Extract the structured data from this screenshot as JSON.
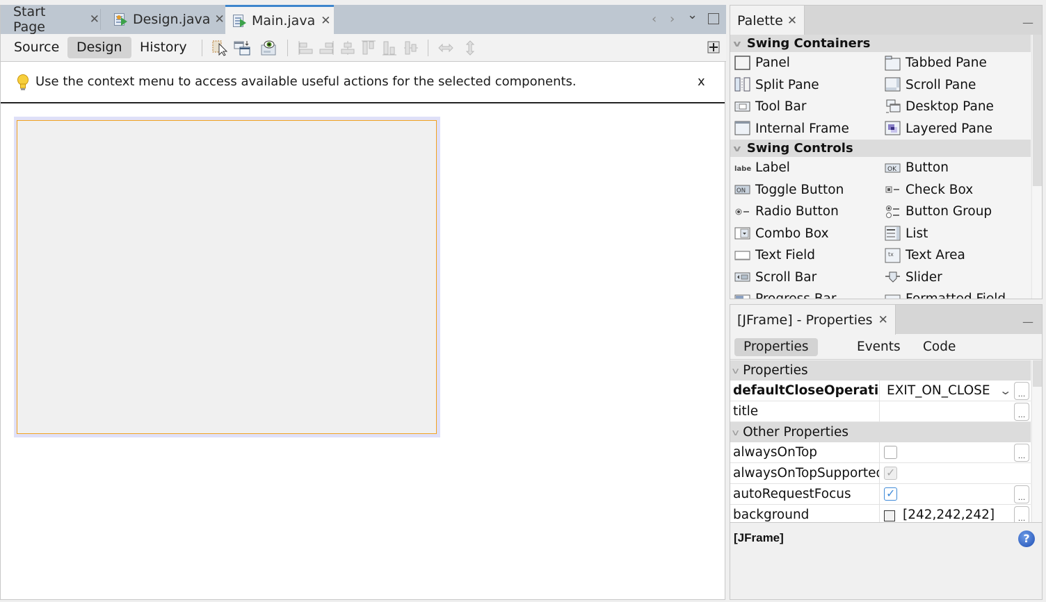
{
  "editor": {
    "tabs": [
      {
        "label": "Start Page",
        "icon": "start-page-icon",
        "active": false
      },
      {
        "label": "Design.java",
        "icon": "java-form-icon",
        "active": false
      },
      {
        "label": "Main.java",
        "icon": "java-form-icon",
        "active": true
      }
    ],
    "tab_close_glyph": "✕",
    "tabbar_controls": {
      "prev": "‹",
      "next": "›",
      "menu": "⌄"
    },
    "view_tabs": [
      {
        "label": "Source",
        "active": false
      },
      {
        "label": "Design",
        "active": true
      },
      {
        "label": "History",
        "active": false
      }
    ],
    "toolbar_icons": [
      "selection-mode-icon",
      "connection-mode-icon",
      "preview-design-icon",
      "align-left-icon",
      "align-right-icon",
      "center-horizontal-icon",
      "align-top-icon",
      "align-bottom-icon",
      "center-vertical-icon",
      "horizontal-resize-icon",
      "vertical-resize-icon",
      "layout-options-icon"
    ],
    "hint": {
      "icon": "lightbulb-icon",
      "text": "Use the context menu to access available useful actions for the selected components.",
      "close": "x"
    },
    "colors": {
      "tab_accent": "#3d84cc",
      "selection_border": "#f2a21f",
      "frame_halo": "#dfe0f8",
      "frame_fill": "#f0f0f0"
    }
  },
  "palette": {
    "title": "Palette",
    "close": "✕",
    "minimize": "—",
    "categories": [
      {
        "label": "Swing Containers",
        "items": [
          "Panel",
          "Tabbed Pane",
          "Split Pane",
          "Scroll Pane",
          "Tool Bar",
          "Desktop Pane",
          "Internal Frame",
          "Layered Pane"
        ]
      },
      {
        "label": "Swing Controls",
        "items": [
          "Label",
          "Button",
          "Toggle Button",
          "Check Box",
          "Radio Button",
          "Button Group",
          "Combo Box",
          "List",
          "Text Field",
          "Text Area",
          "Scroll Bar",
          "Slider",
          "Progress Bar",
          "Formatted Field"
        ]
      }
    ]
  },
  "properties": {
    "title": "[JFrame] - Properties",
    "close": "✕",
    "minimize": "—",
    "tabs": [
      {
        "label": "Properties",
        "active": true
      },
      {
        "label": "Events",
        "active": false
      },
      {
        "label": "Code",
        "active": false
      }
    ],
    "sections": [
      {
        "label": "Properties",
        "rows": [
          {
            "name": "defaultCloseOperation",
            "bold": true,
            "type": "combo",
            "value": "EXIT_ON_CLOSE",
            "customizer": true
          },
          {
            "name": "title",
            "bold": false,
            "type": "text",
            "value": "",
            "customizer": true
          }
        ]
      },
      {
        "label": "Other Properties",
        "rows": [
          {
            "name": "alwaysOnTop",
            "bold": false,
            "type": "checkbox",
            "checked": false,
            "disabled": false,
            "customizer": true
          },
          {
            "name": "alwaysOnTopSupported",
            "bold": false,
            "type": "checkbox",
            "checked": true,
            "disabled": true,
            "customizer": false
          },
          {
            "name": "autoRequestFocus",
            "bold": false,
            "type": "checkbox",
            "checked": true,
            "disabled": false,
            "customizer": true
          },
          {
            "name": "background",
            "bold": false,
            "type": "color",
            "value": "[242,242,242]",
            "swatch": "#f2f2f2",
            "customizer": true
          }
        ]
      }
    ],
    "customizer_label": "...",
    "combo_arrow": "⌄",
    "description_title": "[JFrame]",
    "help": "?"
  }
}
